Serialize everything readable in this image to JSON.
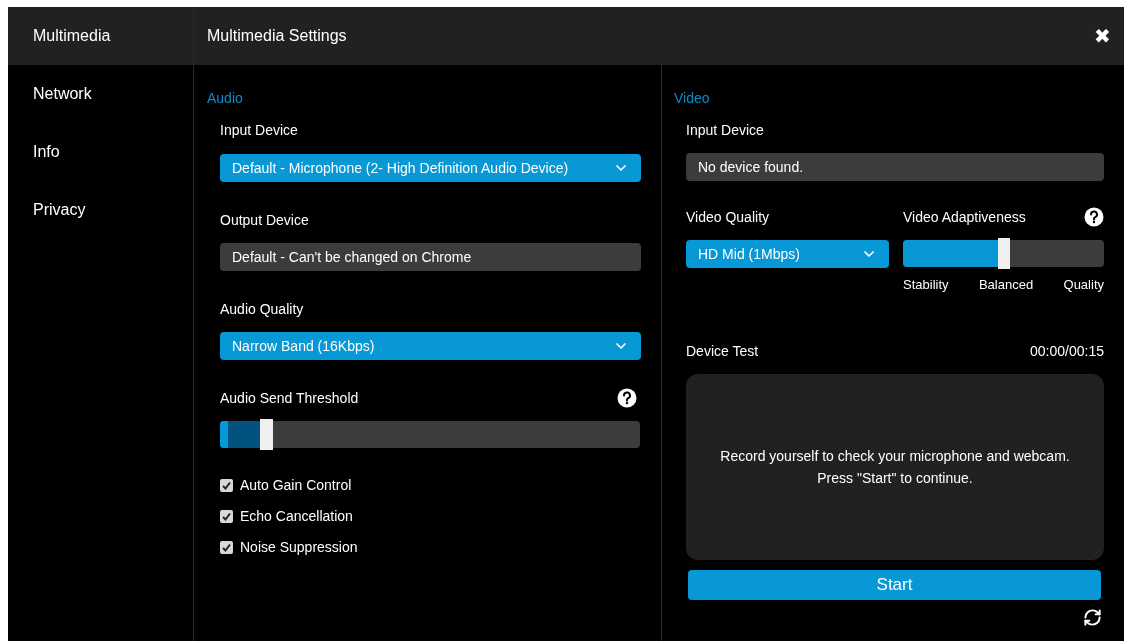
{
  "sidebar": {
    "items": [
      {
        "label": "Multimedia",
        "selected": true
      },
      {
        "label": "Network",
        "selected": false
      },
      {
        "label": "Info",
        "selected": false
      },
      {
        "label": "Privacy",
        "selected": false
      }
    ]
  },
  "window": {
    "title": "Multimedia Settings",
    "close": "✖"
  },
  "audio": {
    "heading": "Audio",
    "input_device": {
      "label": "Input Device",
      "value": "Default - Microphone (2- High Definition Audio Device)"
    },
    "output_device": {
      "label": "Output Device",
      "value": "Default - Can't be changed on Chrome",
      "disabled": true
    },
    "audio_quality": {
      "label": "Audio Quality",
      "value": "Narrow Band (16Kbps)"
    },
    "send_threshold": {
      "label": "Audio Send Threshold",
      "level": 0.11,
      "meter": {
        "level": 0.02
      }
    },
    "options": [
      {
        "label": "Auto Gain Control",
        "checked": true
      },
      {
        "label": "Echo Cancellation",
        "checked": true
      },
      {
        "label": "Noise Suppression",
        "checked": true
      }
    ]
  },
  "video": {
    "heading": "Video",
    "input_device": {
      "label": "Input Device",
      "value": "No device found.",
      "disabled": true
    },
    "video_quality": {
      "label": "Video Quality",
      "value": "HD Mid (1Mbps)"
    },
    "adaptiveness": {
      "label": "Video Adaptiveness",
      "level": 0.5,
      "ticks": [
        "Stability",
        "Balanced",
        "Quality"
      ]
    },
    "device_test": {
      "label": "Device Test",
      "timer": "00:00/00:15",
      "message": [
        "Record yourself to check your microphone and webcam.",
        "Press \"Start\" to continue."
      ],
      "button": "Start"
    }
  }
}
